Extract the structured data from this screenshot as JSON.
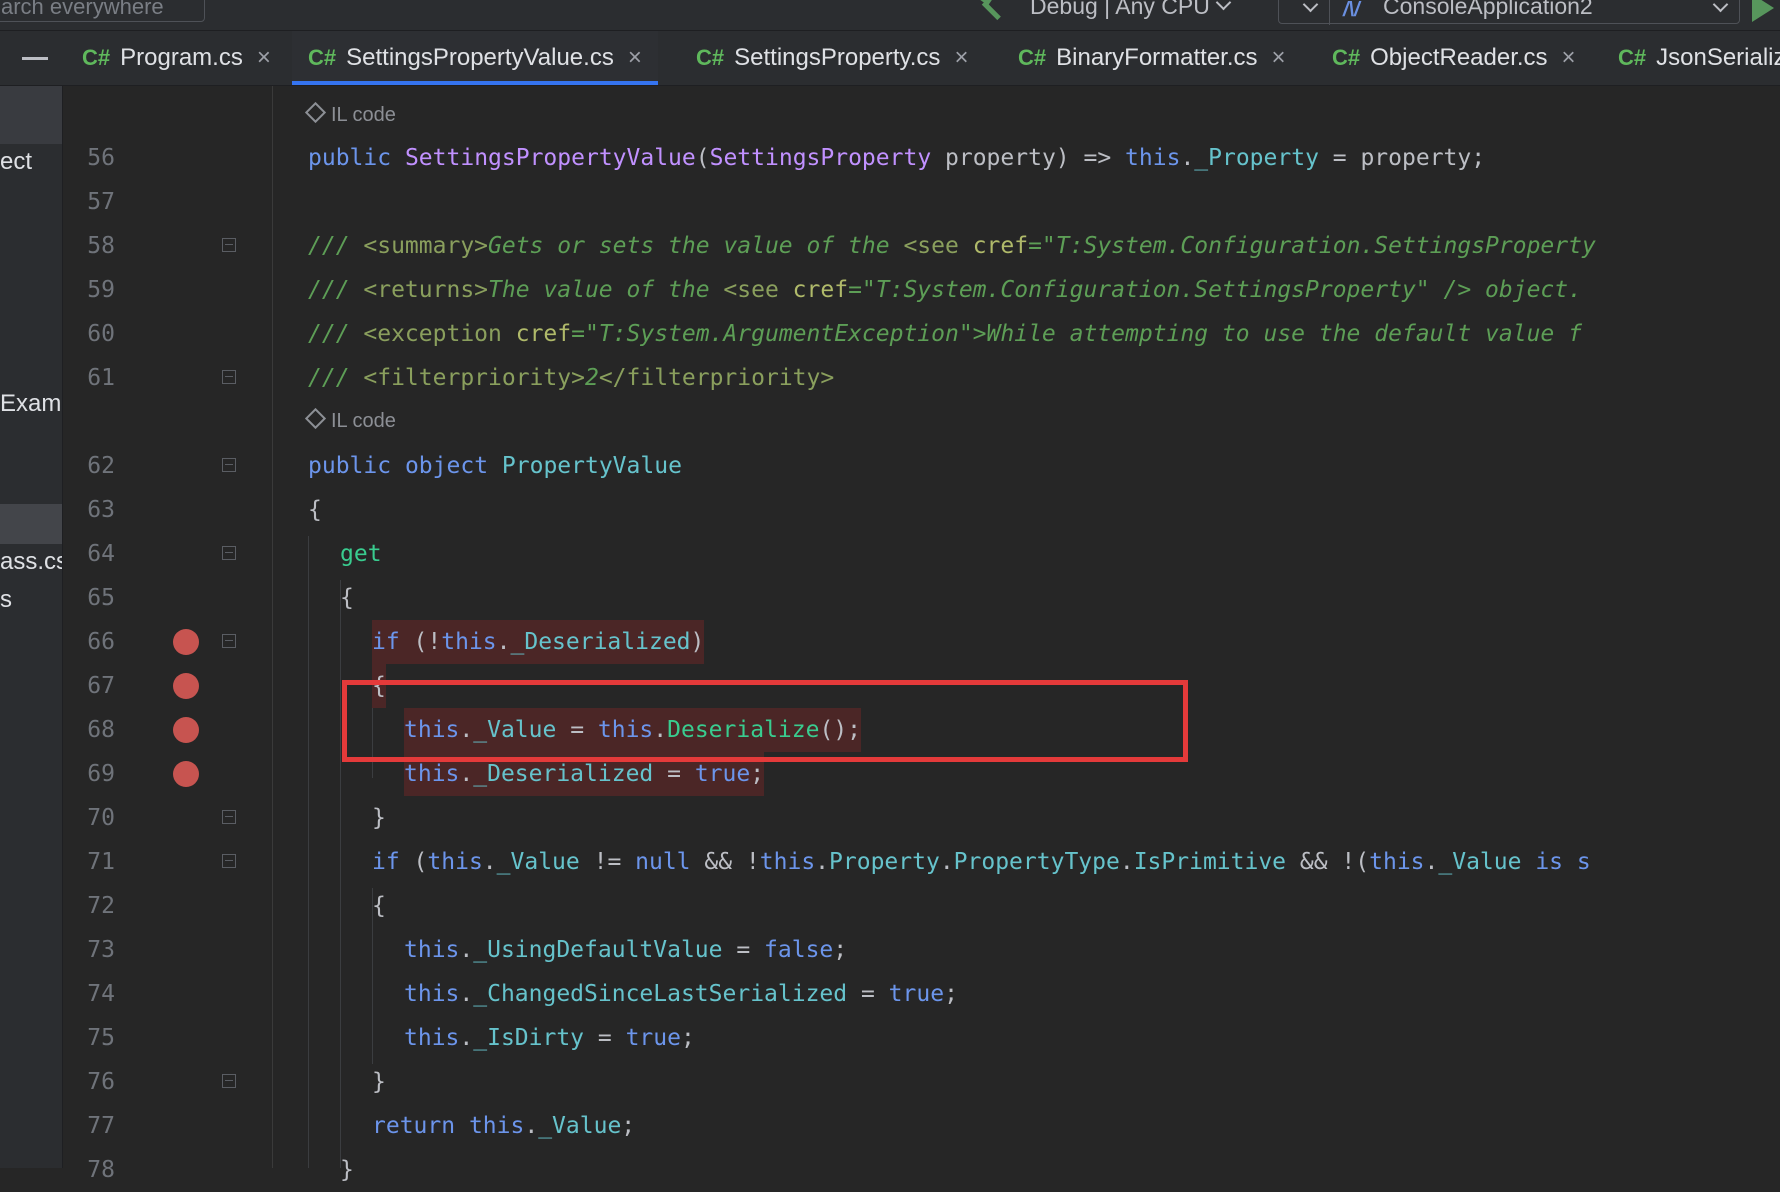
{
  "toolbar": {
    "search_placeholder": "Search everywhere",
    "search_visible_text": "arch everywhere",
    "build_config": "Debug | Any CPU",
    "run_config": "ConsoleApplication2",
    "run_icon": "dotnet-icon"
  },
  "tabs": [
    {
      "lang": "C#",
      "label": "Program.cs",
      "close": "×"
    },
    {
      "lang": "C#",
      "label": "SettingsPropertyValue.cs",
      "close": "×",
      "active": true
    },
    {
      "lang": "C#",
      "label": "SettingsProperty.cs",
      "close": "×"
    },
    {
      "lang": "C#",
      "label": "BinaryFormatter.cs",
      "close": "×"
    },
    {
      "lang": "C#",
      "label": "ObjectReader.cs",
      "close": "×"
    },
    {
      "lang": "C#",
      "label": "JsonSerializ",
      "close": ""
    }
  ],
  "project_panel": {
    "fragments": [
      "ect",
      "Examp",
      "ass.cs",
      "s"
    ]
  },
  "editor": {
    "il_hint": "IL code",
    "lines": [
      "56",
      "57",
      "58",
      "59",
      "60",
      "61",
      "62",
      "63",
      "64",
      "65",
      "66",
      "67",
      "68",
      "69",
      "70",
      "71",
      "72",
      "73",
      "74",
      "75",
      "76",
      "77",
      "78"
    ],
    "breakpoint_lines": [
      "66",
      "67",
      "68",
      "69"
    ],
    "highlight": {
      "color": "#e43a3a",
      "line": "68",
      "text": "this._Value = this.Deserialize();"
    }
  },
  "colors": {
    "background": "#262626",
    "keyword": "#6c95eb",
    "type": "#c191ff",
    "member": "#66c3cc",
    "method": "#39cc8f",
    "doc_comment": "#5d9e56",
    "breakpoint": "#c75450",
    "active_tab_underline": "#3574f0"
  }
}
